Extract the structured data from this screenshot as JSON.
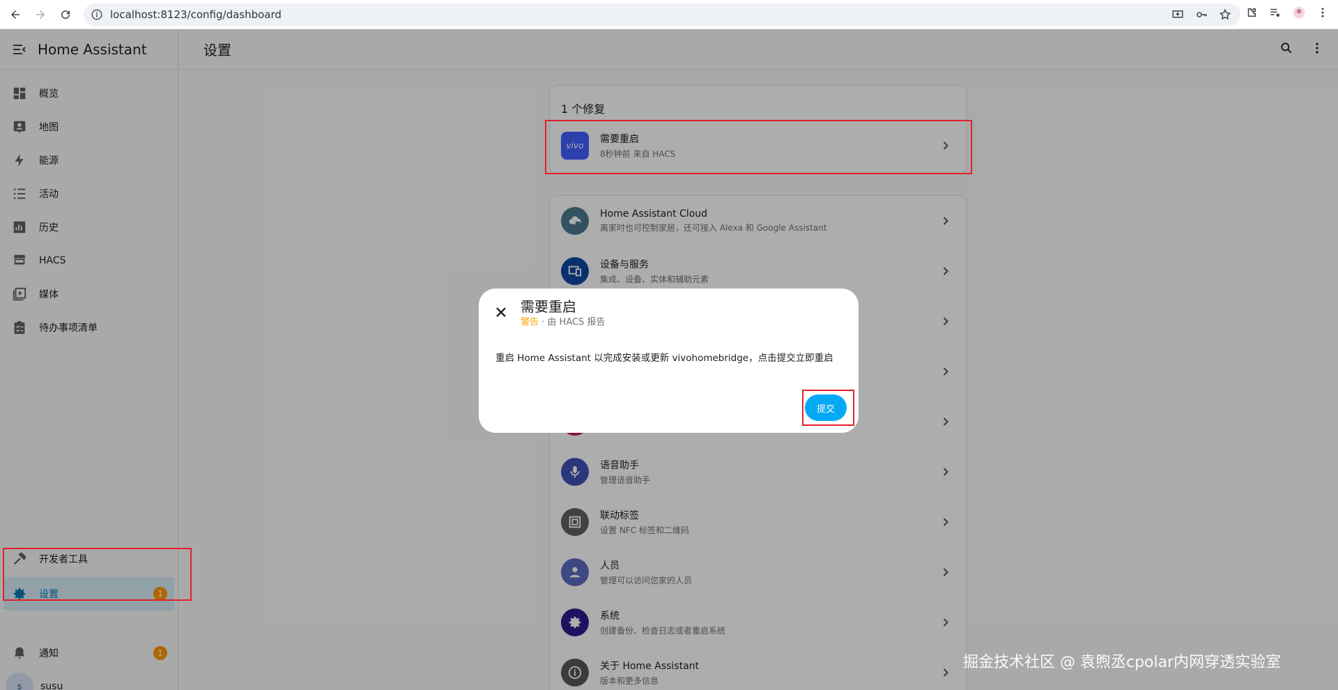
{
  "browser": {
    "url": "localhost:8123/config/dashboard"
  },
  "sidebar": {
    "title": "Home Assistant",
    "items": [
      {
        "label": "概览",
        "icon": "dashboard-icon"
      },
      {
        "label": "地图",
        "icon": "map-icon"
      },
      {
        "label": "能源",
        "icon": "energy-icon"
      },
      {
        "label": "活动",
        "icon": "logbook-icon"
      },
      {
        "label": "历史",
        "icon": "history-icon"
      },
      {
        "label": "HACS",
        "icon": "hacs-icon"
      },
      {
        "label": "媒体",
        "icon": "media-icon"
      },
      {
        "label": "待办事项清单",
        "icon": "todo-icon"
      }
    ],
    "dev_tools": "开发者工具",
    "settings": "设置",
    "settings_badge": "1",
    "notifications": "通知",
    "notifications_badge": "1",
    "user_initial": "s",
    "user_name": "susu"
  },
  "header": {
    "title": "设置"
  },
  "repairs": {
    "title": "1 个修复",
    "item_title": "需要重启",
    "item_sub": "8秒钟前 来自 HACS",
    "item_logo": "vivo"
  },
  "menu": [
    {
      "title": "Home Assistant Cloud",
      "sub": "离家时也可控制家居，还可接入 Alexa 和 Google Assistant",
      "color": "#4a7a8c"
    },
    {
      "title": "设备与服务",
      "sub": "集成、设备、实体和辅助元素",
      "color": "#0d47a1"
    },
    {
      "title": "",
      "sub": "",
      "color": "#1e88e5"
    },
    {
      "title": "",
      "sub": "",
      "color": "#7cb342"
    },
    {
      "title": "",
      "sub": "",
      "color": "#c2185b"
    },
    {
      "title": "语音助手",
      "sub": "管理语音助手",
      "color": "#3f51b5"
    },
    {
      "title": "联动标签",
      "sub": "设置 NFC 标签和二维码",
      "color": "#616161"
    },
    {
      "title": "人员",
      "sub": "管理可以访问您家的人员",
      "color": "#5c6bc0"
    },
    {
      "title": "系统",
      "sub": "创建备份、检查日志或者重启系统",
      "color": "#301a8e"
    },
    {
      "title": "关于 Home Assistant",
      "sub": "版本和更多信息",
      "color": "#585858"
    }
  ],
  "dialog": {
    "title": "需要重启",
    "warn": "警告",
    "sub_rest": " · 由 HACS 报告",
    "body": "重启 Home Assistant 以完成安装或更新 vivohomebridge，点击提交立即重启",
    "submit": "提交"
  },
  "watermark": "掘金技术社区 @ 袁煦丞cpolar内网穿透实验室"
}
